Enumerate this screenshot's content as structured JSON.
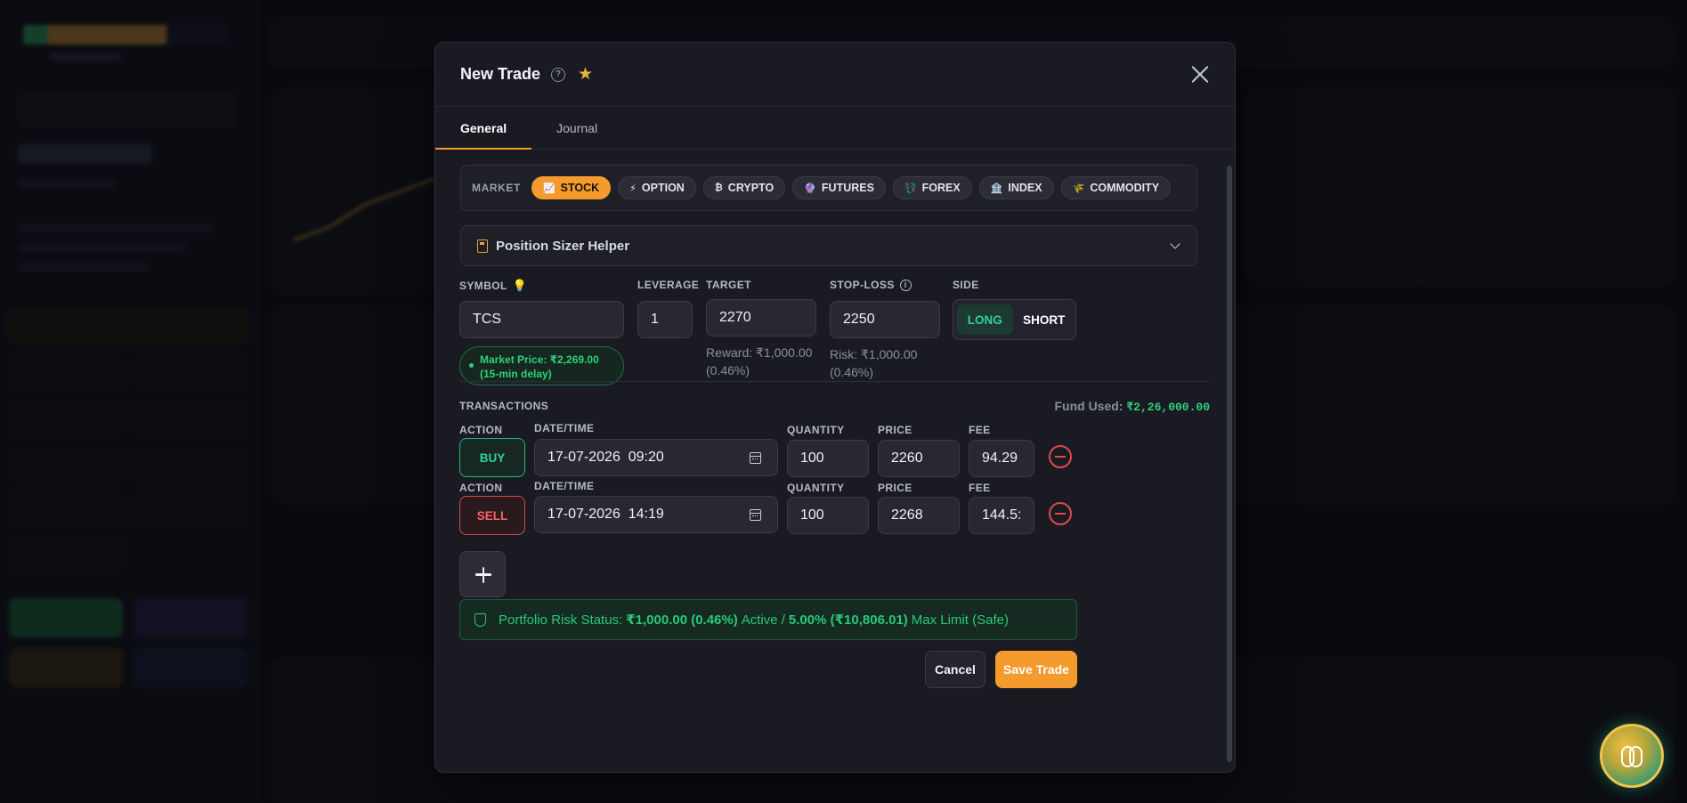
{
  "modal": {
    "title": "New Trade",
    "tabs": [
      "General",
      "Journal"
    ]
  },
  "market": {
    "label": "MARKET",
    "options": [
      {
        "label": "STOCK",
        "icon": "📈",
        "active": true
      },
      {
        "label": "OPTION",
        "icon": "⚡",
        "active": false
      },
      {
        "label": "CRYPTO",
        "icon": "₿",
        "active": false
      },
      {
        "label": "FUTURES",
        "icon": "🔮",
        "active": false
      },
      {
        "label": "FOREX",
        "icon": "💱",
        "active": false
      },
      {
        "label": "INDEX",
        "icon": "🏦",
        "active": false
      },
      {
        "label": "COMMODITY",
        "icon": "🌾",
        "active": false
      }
    ]
  },
  "position_sizer": {
    "label": "Position Sizer Helper"
  },
  "form": {
    "symbol_label": "SYMBOL",
    "symbol_value": "TCS",
    "market_price": "Market Price: ₹2,269.00 (15-min delay)",
    "leverage_label": "LEVERAGE",
    "leverage_value": "1",
    "target_label": "TARGET",
    "target_value": "2270",
    "target_sub_1": "Reward: ₹1,000.00",
    "target_sub_2": "(0.46%)",
    "stoploss_label": "STOP-LOSS",
    "stoploss_value": "2250",
    "stoploss_sub_1": "Risk: ₹1,000.00",
    "stoploss_sub_2": "(0.46%)",
    "side_label": "SIDE",
    "side_long": "LONG",
    "side_short": "SHORT",
    "side_selected": "LONG"
  },
  "transactions": {
    "label": "TRANSACTIONS",
    "fund_used_label": "Fund Used:",
    "fund_used_value": "₹2,26,000.00",
    "col_action": "ACTION",
    "col_datetime": "DATE/TIME",
    "col_quantity": "QUANTITY",
    "col_price": "PRICE",
    "col_fee": "FEE",
    "rows": [
      {
        "action": "BUY",
        "datetime": "17-07-2026  09:20",
        "quantity": "100",
        "price": "2260",
        "fee": "94.29"
      },
      {
        "action": "SELL",
        "datetime": "17-07-2026  14:19",
        "quantity": "100",
        "price": "2268",
        "fee": "144.5:"
      }
    ]
  },
  "risk_status": {
    "prefix": "Portfolio Risk Status:",
    "active_value": "₹1,000.00 (0.46%)",
    "active_label": "Active /",
    "max_value": "5.00% (₹10,806.01)",
    "max_label": "Max Limit (Safe)"
  },
  "footer": {
    "cancel_label": "Cancel",
    "save_label": "Save Trade"
  }
}
